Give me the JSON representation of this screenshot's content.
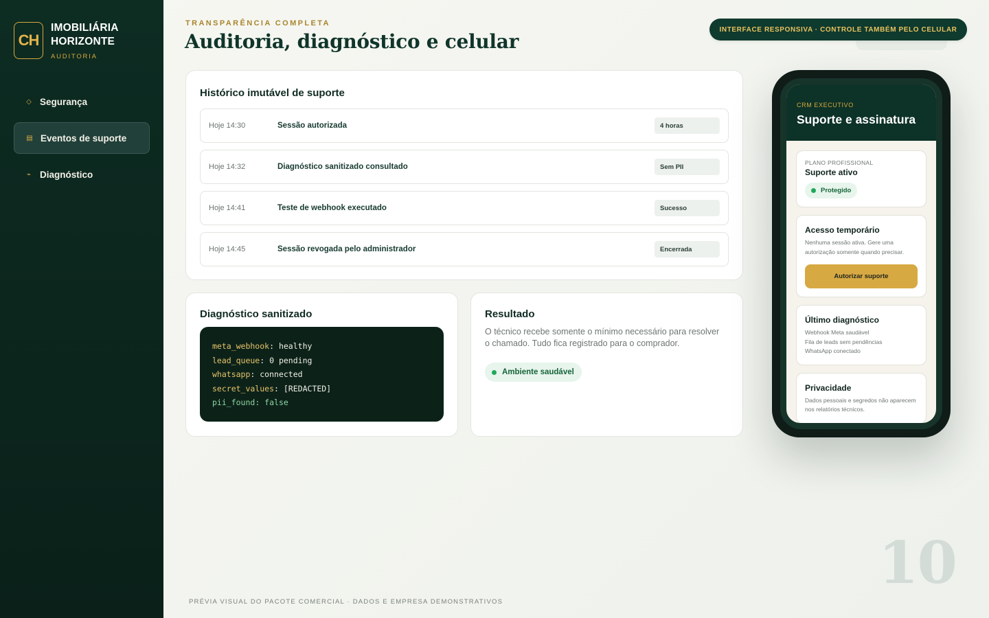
{
  "brand": {
    "logo": "CH",
    "name_line1": "IMOBILIÁRIA",
    "name_line2": "HORIZONTE",
    "subtitle": "AUDITORIA"
  },
  "sidebar": {
    "items": [
      {
        "label": "Segurança",
        "icon": "diamond-icon",
        "active": false
      },
      {
        "label": "Eventos de suporte",
        "icon": "calendar-icon",
        "active": true
      },
      {
        "label": "Diagnóstico",
        "icon": "pulse-icon",
        "active": false
      }
    ]
  },
  "header": {
    "eyebrow": "TRANSPARÊNCIA COMPLETA",
    "title": "Auditoria, diagnóstico e celular",
    "pill": "INTERFACE RESPONSIVA · CONTROLE TAMBÉM PELO CELULAR"
  },
  "history": {
    "title": "Histórico imutável de suporte",
    "rows": [
      {
        "time": "Hoje 14:30",
        "event": "Sessão autorizada",
        "badge": "4 horas"
      },
      {
        "time": "Hoje 14:32",
        "event": "Diagnóstico sanitizado consultado",
        "badge": "Sem PII"
      },
      {
        "time": "Hoje 14:41",
        "event": "Teste de webhook executado",
        "badge": "Sucesso"
      },
      {
        "time": "Hoje 14:45",
        "event": "Sessão revogada pelo administrador",
        "badge": "Encerrada"
      }
    ]
  },
  "diagnostic": {
    "title": "Diagnóstico sanitizado",
    "lines": [
      {
        "key": "meta_webhook",
        "sep": ": ",
        "value": "healthy"
      },
      {
        "key": "lead_queue",
        "sep": ": ",
        "value": "0 pending"
      },
      {
        "key": "whatsapp",
        "sep": ": ",
        "value": "connected"
      },
      {
        "key": "secret_values",
        "sep": ": ",
        "value": "[REDACTED]"
      },
      {
        "key": "pii_found",
        "sep": ": ",
        "value": "false"
      }
    ]
  },
  "result": {
    "title": "Resultado",
    "description": "O técnico recebe somente o mínimo necessário para resolver o chamado. Tudo fica registrado para o comprador.",
    "status": "Ambiente saudável",
    "status_color": "#1fa85a"
  },
  "phone": {
    "eyebrow": "CRM EXECUTIVO",
    "title": "Suporte e assinatura",
    "plan": {
      "eyebrow": "PLANO PROFISSIONAL",
      "title": "Suporte ativo",
      "badge": "Protegido"
    },
    "access": {
      "title": "Acesso temporário",
      "text": "Nenhuma sessão ativa. Gere uma autorização somente quando precisar.",
      "button": "Autorizar suporte"
    },
    "last_diag": {
      "title": "Último diagnóstico",
      "lines": [
        "Webhook Meta saudável",
        "Fila de leads sem pendências",
        "WhatsApp conectado"
      ]
    },
    "privacy": {
      "title": "Privacidade",
      "text": "Dados pessoais e segredos não aparecem nos relatórios técnicos."
    }
  },
  "footer": {
    "note": "PRÉVIA VISUAL DO PACOTE COMERCIAL · DADOS E EMPRESA DEMONSTRATIVOS",
    "page_number": "10"
  },
  "colors": {
    "sidebar_bg": "#0d2c22",
    "accent_gold": "#d8a93f",
    "success": "#1fa85a"
  }
}
